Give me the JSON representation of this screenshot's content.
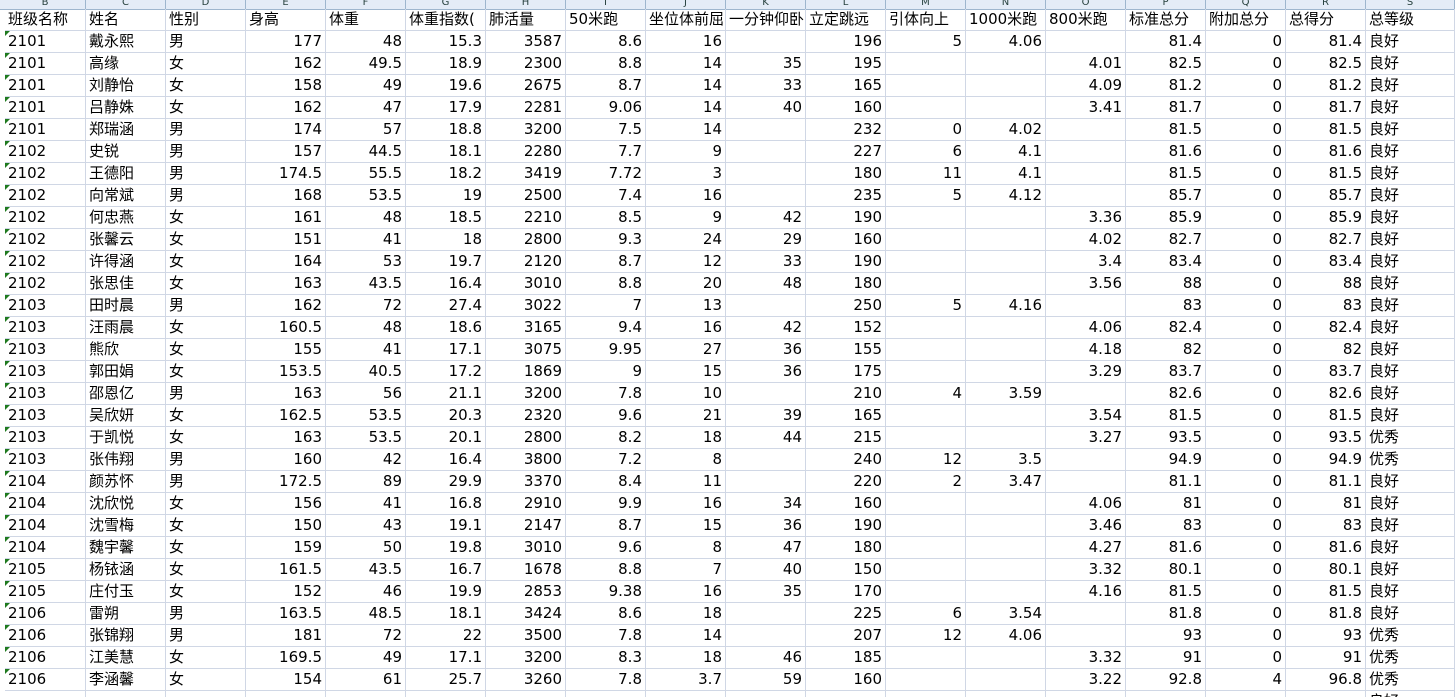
{
  "column_letters": [
    "B",
    "C",
    "D",
    "E",
    "F",
    "G",
    "H",
    "I",
    "J",
    "K",
    "L",
    "M",
    "N",
    "O",
    "P",
    "Q",
    "R",
    "S"
  ],
  "header_row": [
    "班级名称",
    "姓名",
    "性别",
    "身高",
    "体重",
    "体重指数(",
    "肺活量",
    "50米跑",
    "坐位体前屈",
    "一分钟仰卧",
    "立定跳远",
    "引体向上",
    "1000米跑",
    "800米跑",
    "标准总分",
    "附加总分",
    "总得分",
    "总等级"
  ],
  "rows": [
    [
      "2101",
      "戴永熙",
      "男",
      "177",
      "48",
      "15.3",
      "3587",
      "8.6",
      "16",
      "",
      "196",
      "5",
      "4.06",
      "",
      "81.4",
      "0",
      "81.4",
      "良好"
    ],
    [
      "2101",
      "高缘",
      "女",
      "162",
      "49.5",
      "18.9",
      "2300",
      "8.8",
      "14",
      "35",
      "195",
      "",
      "",
      "4.01",
      "82.5",
      "0",
      "82.5",
      "良好"
    ],
    [
      "2101",
      "刘静怡",
      "女",
      "158",
      "49",
      "19.6",
      "2675",
      "8.7",
      "14",
      "33",
      "165",
      "",
      "",
      "4.09",
      "81.2",
      "0",
      "81.2",
      "良好"
    ],
    [
      "2101",
      "吕静姝",
      "女",
      "162",
      "47",
      "17.9",
      "2281",
      "9.06",
      "14",
      "40",
      "160",
      "",
      "",
      "3.41",
      "81.7",
      "0",
      "81.7",
      "良好"
    ],
    [
      "2101",
      "郑瑞涵",
      "男",
      "174",
      "57",
      "18.8",
      "3200",
      "7.5",
      "14",
      "",
      "232",
      "0",
      "4.02",
      "",
      "81.5",
      "0",
      "81.5",
      "良好"
    ],
    [
      "2102",
      "史锐",
      "男",
      "157",
      "44.5",
      "18.1",
      "2280",
      "7.7",
      "9",
      "",
      "227",
      "6",
      "4.1",
      "",
      "81.6",
      "0",
      "81.6",
      "良好"
    ],
    [
      "2102",
      "王德阳",
      "男",
      "174.5",
      "55.5",
      "18.2",
      "3419",
      "7.72",
      "3",
      "",
      "180",
      "11",
      "4.1",
      "",
      "81.5",
      "0",
      "81.5",
      "良好"
    ],
    [
      "2102",
      "向常斌",
      "男",
      "168",
      "53.5",
      "19",
      "2500",
      "7.4",
      "16",
      "",
      "235",
      "5",
      "4.12",
      "",
      "85.7",
      "0",
      "85.7",
      "良好"
    ],
    [
      "2102",
      "何忠燕",
      "女",
      "161",
      "48",
      "18.5",
      "2210",
      "8.5",
      "9",
      "42",
      "190",
      "",
      "",
      "3.36",
      "85.9",
      "0",
      "85.9",
      "良好"
    ],
    [
      "2102",
      "张馨云",
      "女",
      "151",
      "41",
      "18",
      "2800",
      "9.3",
      "24",
      "29",
      "160",
      "",
      "",
      "4.02",
      "82.7",
      "0",
      "82.7",
      "良好"
    ],
    [
      "2102",
      "许得涵",
      "女",
      "164",
      "53",
      "19.7",
      "2120",
      "8.7",
      "12",
      "33",
      "190",
      "",
      "",
      "3.4",
      "83.4",
      "0",
      "83.4",
      "良好"
    ],
    [
      "2102",
      "张思佳",
      "女",
      "163",
      "43.5",
      "16.4",
      "3010",
      "8.8",
      "20",
      "48",
      "180",
      "",
      "",
      "3.56",
      "88",
      "0",
      "88",
      "良好"
    ],
    [
      "2103",
      "田时晨",
      "男",
      "162",
      "72",
      "27.4",
      "3022",
      "7",
      "13",
      "",
      "250",
      "5",
      "4.16",
      "",
      "83",
      "0",
      "83",
      "良好"
    ],
    [
      "2103",
      "汪雨晨",
      "女",
      "160.5",
      "48",
      "18.6",
      "3165",
      "9.4",
      "16",
      "42",
      "152",
      "",
      "",
      "4.06",
      "82.4",
      "0",
      "82.4",
      "良好"
    ],
    [
      "2103",
      "熊欣",
      "女",
      "155",
      "41",
      "17.1",
      "3075",
      "9.95",
      "27",
      "36",
      "155",
      "",
      "",
      "4.18",
      "82",
      "0",
      "82",
      "良好"
    ],
    [
      "2103",
      "郭田娟",
      "女",
      "153.5",
      "40.5",
      "17.2",
      "1869",
      "9",
      "15",
      "36",
      "175",
      "",
      "",
      "3.29",
      "83.7",
      "0",
      "83.7",
      "良好"
    ],
    [
      "2103",
      "邵恩亿",
      "男",
      "163",
      "56",
      "21.1",
      "3200",
      "7.8",
      "10",
      "",
      "210",
      "4",
      "3.59",
      "",
      "82.6",
      "0",
      "82.6",
      "良好"
    ],
    [
      "2103",
      "吴欣妍",
      "女",
      "162.5",
      "53.5",
      "20.3",
      "2320",
      "9.6",
      "21",
      "39",
      "165",
      "",
      "",
      "3.54",
      "81.5",
      "0",
      "81.5",
      "良好"
    ],
    [
      "2103",
      "于凯悦",
      "女",
      "163",
      "53.5",
      "20.1",
      "2800",
      "8.2",
      "18",
      "44",
      "215",
      "",
      "",
      "3.27",
      "93.5",
      "0",
      "93.5",
      "优秀"
    ],
    [
      "2103",
      "张伟翔",
      "男",
      "160",
      "42",
      "16.4",
      "3800",
      "7.2",
      "8",
      "",
      "240",
      "12",
      "3.5",
      "",
      "94.9",
      "0",
      "94.9",
      "优秀"
    ],
    [
      "2104",
      "颜苏怀",
      "男",
      "172.5",
      "89",
      "29.9",
      "3370",
      "8.4",
      "11",
      "",
      "220",
      "2",
      "3.47",
      "",
      "81.1",
      "0",
      "81.1",
      "良好"
    ],
    [
      "2104",
      "沈欣悦",
      "女",
      "156",
      "41",
      "16.8",
      "2910",
      "9.9",
      "16",
      "34",
      "160",
      "",
      "",
      "4.06",
      "81",
      "0",
      "81",
      "良好"
    ],
    [
      "2104",
      "沈雪梅",
      "女",
      "150",
      "43",
      "19.1",
      "2147",
      "8.7",
      "15",
      "36",
      "190",
      "",
      "",
      "3.46",
      "83",
      "0",
      "83",
      "良好"
    ],
    [
      "2104",
      "魏宇馨",
      "女",
      "159",
      "50",
      "19.8",
      "3010",
      "9.6",
      "8",
      "47",
      "180",
      "",
      "",
      "4.27",
      "81.6",
      "0",
      "81.6",
      "良好"
    ],
    [
      "2105",
      "杨铱涵",
      "女",
      "161.5",
      "43.5",
      "16.7",
      "1678",
      "8.8",
      "7",
      "40",
      "150",
      "",
      "",
      "3.32",
      "80.1",
      "0",
      "80.1",
      "良好"
    ],
    [
      "2105",
      "庄付玉",
      "女",
      "152",
      "46",
      "19.9",
      "2853",
      "9.38",
      "16",
      "35",
      "170",
      "",
      "",
      "4.16",
      "81.5",
      "0",
      "81.5",
      "良好"
    ],
    [
      "2106",
      "雷朔",
      "男",
      "163.5",
      "48.5",
      "18.1",
      "3424",
      "8.6",
      "18",
      "",
      "225",
      "6",
      "3.54",
      "",
      "81.8",
      "0",
      "81.8",
      "良好"
    ],
    [
      "2106",
      "张锦翔",
      "男",
      "181",
      "72",
      "22",
      "3500",
      "7.8",
      "14",
      "",
      "207",
      "12",
      "4.06",
      "",
      "93",
      "0",
      "93",
      "优秀"
    ],
    [
      "2106",
      "江美慧",
      "女",
      "169.5",
      "49",
      "17.1",
      "3200",
      "8.3",
      "18",
      "46",
      "185",
      "",
      "",
      "3.32",
      "91",
      "0",
      "91",
      "优秀"
    ],
    [
      "2106",
      "李涵馨",
      "女",
      "154",
      "61",
      "25.7",
      "3260",
      "7.8",
      "3.7",
      "59",
      "160",
      "",
      "",
      "3.22",
      "92.8",
      "4",
      "96.8",
      "优秀"
    ],
    [
      "",
      "",
      "",
      "",
      "",
      "",
      "",
      "",
      "",
      "",
      "",
      "",
      "",
      "",
      "",
      "",
      "",
      "良好"
    ]
  ]
}
